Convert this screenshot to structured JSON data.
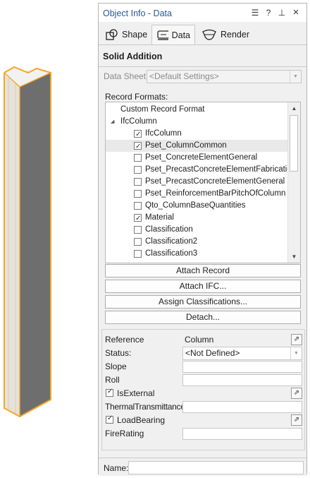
{
  "palette": {
    "title": "Object Info - Data",
    "controls": {
      "menu": "☰",
      "help": "?",
      "pin": "⊥",
      "close": "×"
    }
  },
  "tabs": [
    {
      "label": "Shape",
      "icon": "shape-icon"
    },
    {
      "label": "Data",
      "icon": "data-icon"
    },
    {
      "label": "Render",
      "icon": "render-icon"
    }
  ],
  "section_title": "Solid Addition",
  "data_sheet": {
    "label": "Data Sheet:",
    "value": "<Default Settings>"
  },
  "record_formats": {
    "label": "Record Formats:",
    "items": [
      {
        "text": "Custom Record Format",
        "indent": 0,
        "checkbox": false,
        "checked": false
      },
      {
        "text": "IfcColumn",
        "indent": 0,
        "checkbox": false,
        "checked": false,
        "expander": "◢"
      },
      {
        "text": "IfcColumn",
        "indent": 1,
        "checkbox": true,
        "checked": true
      },
      {
        "text": "Pset_ColumnCommon",
        "indent": 1,
        "checkbox": true,
        "checked": true,
        "selected": true
      },
      {
        "text": "Pset_ConcreteElementGeneral",
        "indent": 1,
        "checkbox": true,
        "checked": false
      },
      {
        "text": "Pset_PrecastConcreteElementFabrication",
        "indent": 1,
        "checkbox": true,
        "checked": false
      },
      {
        "text": "Pset_PrecastConcreteElementGeneral",
        "indent": 1,
        "checkbox": true,
        "checked": false
      },
      {
        "text": "Pset_ReinforcementBarPitchOfColumn",
        "indent": 1,
        "checkbox": true,
        "checked": false
      },
      {
        "text": "Qto_ColumnBaseQuantities",
        "indent": 1,
        "checkbox": true,
        "checked": false
      },
      {
        "text": "Material",
        "indent": 1,
        "checkbox": true,
        "checked": true
      },
      {
        "text": "Classification",
        "indent": 1,
        "checkbox": true,
        "checked": false
      },
      {
        "text": "Classification2",
        "indent": 1,
        "checkbox": true,
        "checked": false
      },
      {
        "text": "Classification3",
        "indent": 1,
        "checkbox": true,
        "checked": false
      }
    ]
  },
  "buttons": {
    "attach_record": "Attach Record",
    "attach_ifc": "Attach IFC...",
    "assign_classifications": "Assign Classifications...",
    "detach": "Detach..."
  },
  "properties": {
    "reference": {
      "label": "Reference",
      "value": "Column"
    },
    "status": {
      "label": "Status:",
      "value": "<Not Defined>"
    },
    "slope": {
      "label": "Slope",
      "value": ""
    },
    "roll": {
      "label": "Roll",
      "value": ""
    },
    "is_external": {
      "label": "IsExternal",
      "checked": true
    },
    "thermal_transmittance": {
      "label": "ThermalTransmittance",
      "value": ""
    },
    "load_bearing": {
      "label": "LoadBearing",
      "checked": true
    },
    "fire_rating": {
      "label": "FireRating",
      "value": ""
    }
  },
  "name_field": {
    "label": "Name:",
    "value": ""
  },
  "colors": {
    "accent": "#2b5797",
    "selection_highlight": "#f5a623"
  }
}
